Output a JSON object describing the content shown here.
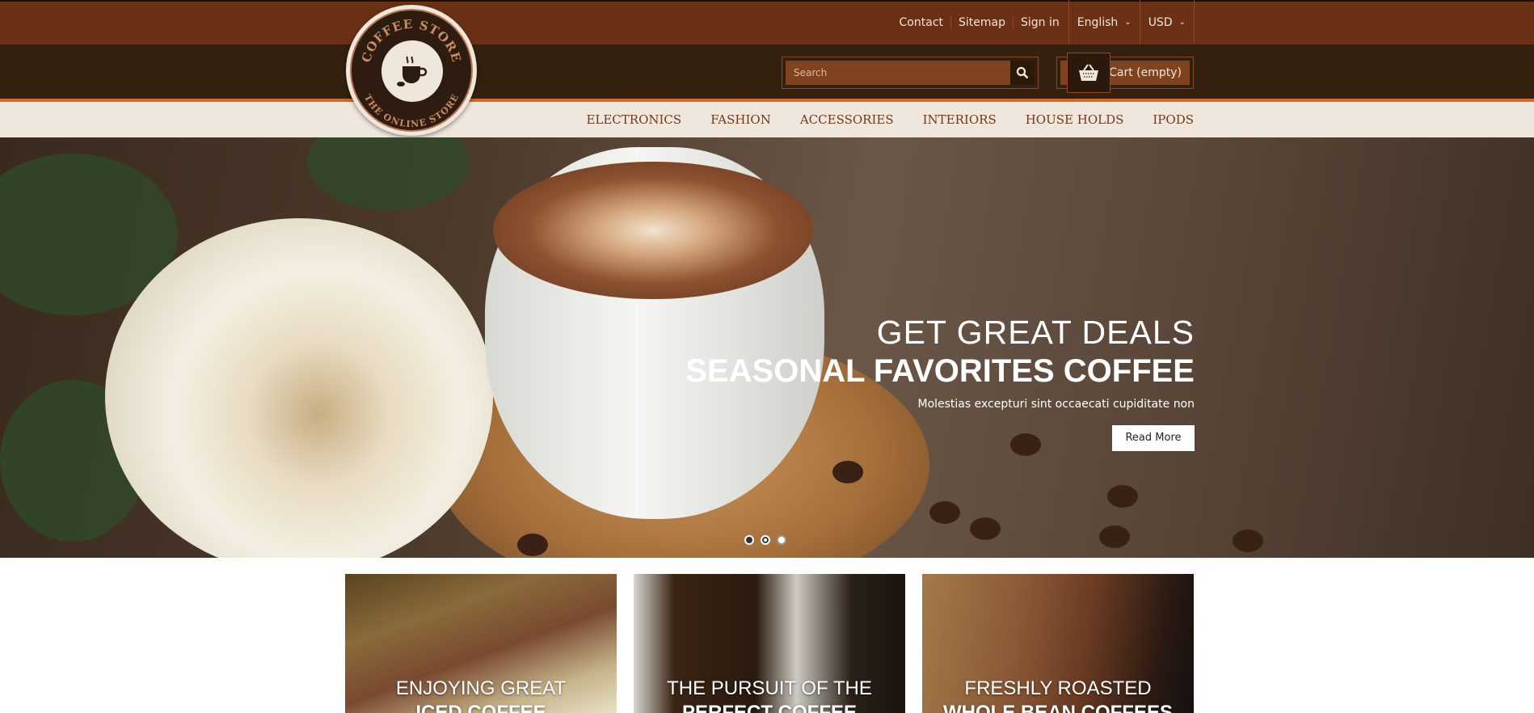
{
  "header": {
    "top_links": [
      "Contact",
      "Sitemap",
      "Sign in"
    ],
    "language": "English",
    "currency": "USD",
    "search_placeholder": "Search",
    "cart_label": "Cart (empty)",
    "logo_text": [
      "COFFEE STORE",
      "THE ONLINE STORE"
    ]
  },
  "nav": [
    "ELECTRONICS",
    "FASHION",
    "ACCESSORIES",
    "INTERIORS",
    "HOUSE HOLDS",
    "IPODS"
  ],
  "hero": {
    "line1": "GET GREAT DEALS",
    "line2": "SEASONAL FAVORITES COFFEE",
    "subtitle": "Molestias excepturi sint occaecati cupiditate non",
    "button": "Read More",
    "slides": 3,
    "active_slide": 2
  },
  "cards": [
    {
      "line1": "ENJOYING GREAT",
      "line2": "ICED COFFEE"
    },
    {
      "line1": "THE PURSUIT OF THE",
      "line2": "PERFECT COFFEE"
    },
    {
      "line1": "FRESHLY ROASTED",
      "line2": "WHOLE BEAN COFFEES"
    }
  ],
  "colors": {
    "topbar": "#6b3114",
    "midbar": "#33200f",
    "accent": "#d2691e",
    "nav_bg": "#f0e7dc",
    "nav_text": "#6b3a1e"
  }
}
